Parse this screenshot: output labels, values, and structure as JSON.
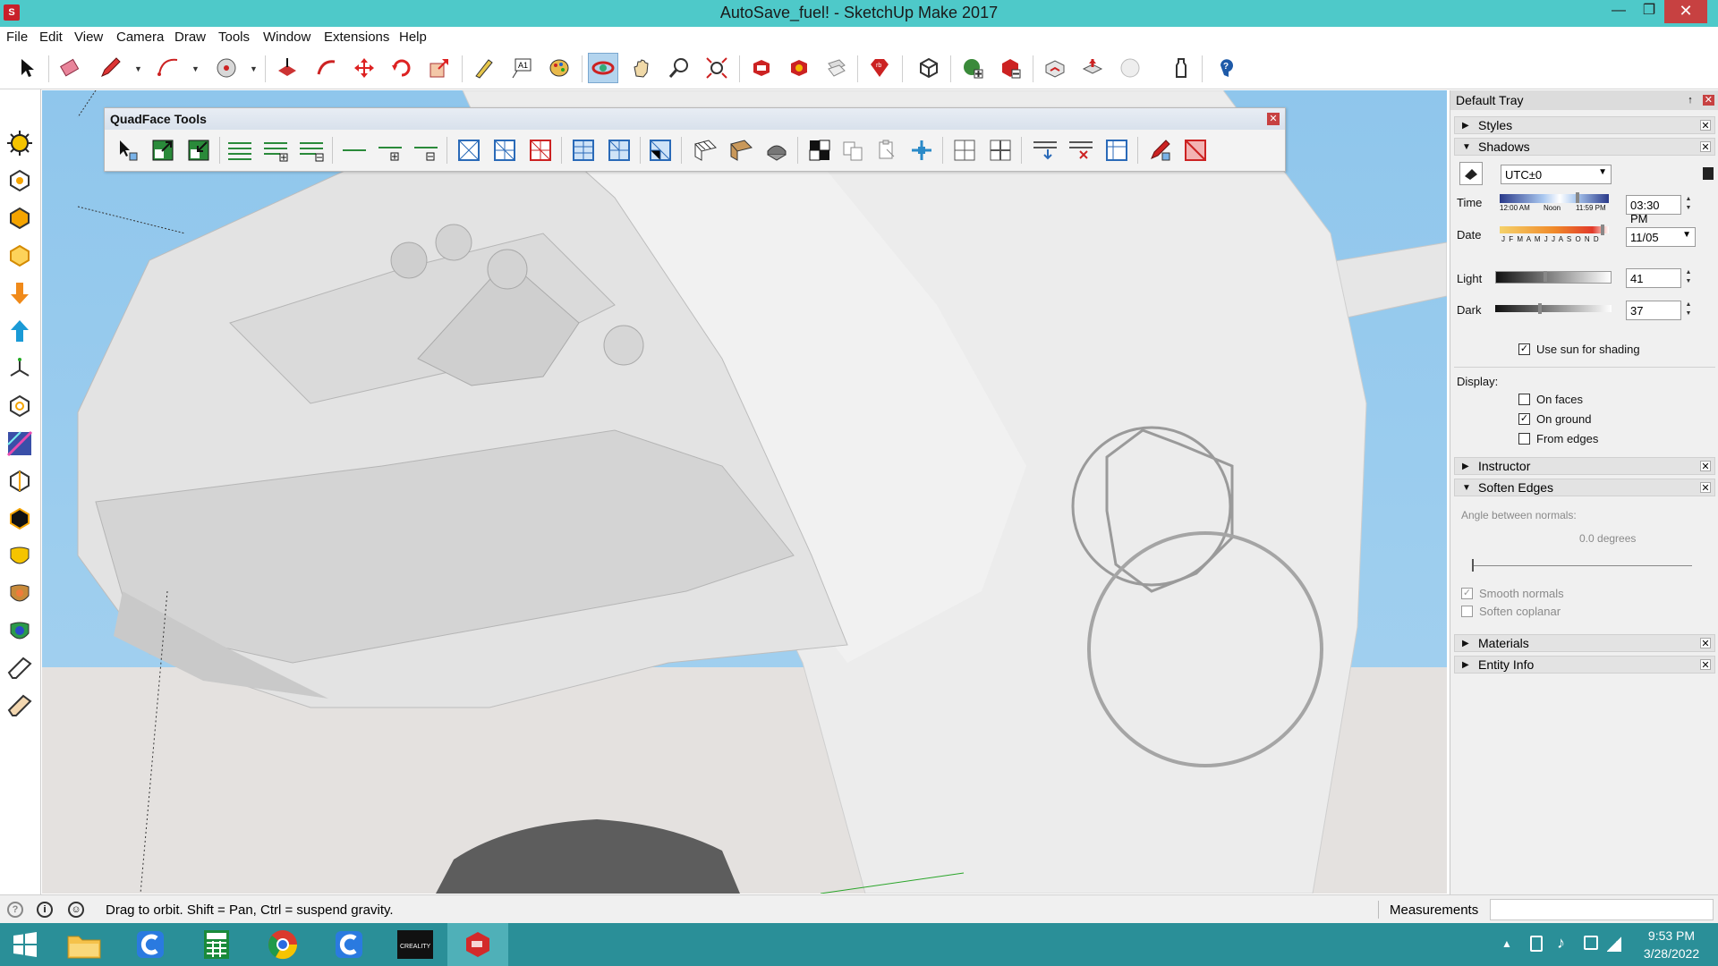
{
  "window": {
    "title": "AutoSave_fuel! - SketchUp Make 2017",
    "app_icon": "sketchup-logo",
    "minimize": "—",
    "maximize": "❐",
    "close": "✕"
  },
  "menu": [
    "File",
    "Edit",
    "View",
    "Camera",
    "Draw",
    "Tools",
    "Window",
    "Extensions",
    "Help"
  ],
  "main_toolbar": {
    "icons": [
      "select-icon",
      "eraser-icon",
      "pencil-icon",
      "arc-icon",
      "paint-bucket-icon",
      "push-pull-icon",
      "follow-me-icon",
      "move-icon",
      "rotate-icon",
      "scale-icon",
      "tape-measure-icon",
      "text-icon",
      "paint-icon",
      "orbit-icon",
      "pan-icon",
      "zoom-icon",
      "zoom-extents-icon",
      "3d-warehouse-icon",
      "extension-warehouse-icon",
      "layout-icon",
      "ruby-icon",
      "component-icon",
      "solid-add-icon",
      "solid-subtract-icon",
      "sandbox-icon",
      "sandbox-stamp-icon",
      "sphere-icon",
      "bottle-icon",
      "help-icon"
    ]
  },
  "quadface": {
    "title": "QuadFace Tools",
    "close": "✕"
  },
  "left_toolbar": {
    "icons": [
      "sun-icon",
      "shape-1-icon",
      "shape-2-icon",
      "shape-3-icon",
      "arrow-down-icon",
      "arrow-up-icon",
      "axes-icon",
      "shape-4-icon",
      "section-icon",
      "shape-5-icon",
      "shape-6-icon",
      "shape-7-icon",
      "shape-8-icon",
      "shape-9-icon",
      "eraser-small-icon",
      "pencil-small-icon"
    ]
  },
  "tray": {
    "title": "Default Tray",
    "pin": "↑",
    "close": "✕",
    "panels": {
      "styles": "Styles",
      "shadows": "Shadows",
      "instructor": "Instructor",
      "soften_edges": "Soften Edges",
      "materials": "Materials",
      "entity_info": "Entity Info"
    },
    "shadows": {
      "timezone": "UTC±0",
      "time_label": "Time",
      "time_ticks": [
        "12:00 AM",
        "Noon",
        "11:59 PM"
      ],
      "time_value": "03:30 PM",
      "date_label": "Date",
      "date_ticks": "J F M A M J J A S O N D",
      "date_value": "11/05",
      "light_label": "Light",
      "light_value": "41",
      "dark_label": "Dark",
      "dark_value": "37",
      "use_sun_label": "Use sun for shading",
      "display_label": "Display:",
      "on_faces": "On faces",
      "on_ground": "On ground",
      "from_edges": "From edges",
      "use_sun_checked": true,
      "on_faces_checked": false,
      "on_ground_checked": true,
      "from_edges_checked": false
    },
    "soften": {
      "angle_label": "Angle between normals:",
      "angle_value": "0.0  degrees",
      "smooth_normals": "Smooth normals",
      "soften_coplanar": "Soften coplanar",
      "smooth_checked": true,
      "coplanar_checked": false
    }
  },
  "status": {
    "text": "Drag to orbit. Shift = Pan, Ctrl = suspend gravity.",
    "measurements_label": "Measurements",
    "measurements_value": ""
  },
  "taskbar": {
    "items": [
      "windows-start-icon",
      "file-explorer-icon",
      "ccleaner-icon",
      "calculator-icon",
      "chrome-icon",
      "ccleaner-2-icon",
      "creality-icon",
      "sketchup-icon"
    ],
    "time": "9:53 PM",
    "date": "3/28/2022"
  },
  "colors": {
    "titlebar": "#4ec9c9",
    "taskbar": "#2a8f98",
    "sky": "#8fc6ec",
    "ground": "#e4e1df",
    "model": "#ececec"
  }
}
